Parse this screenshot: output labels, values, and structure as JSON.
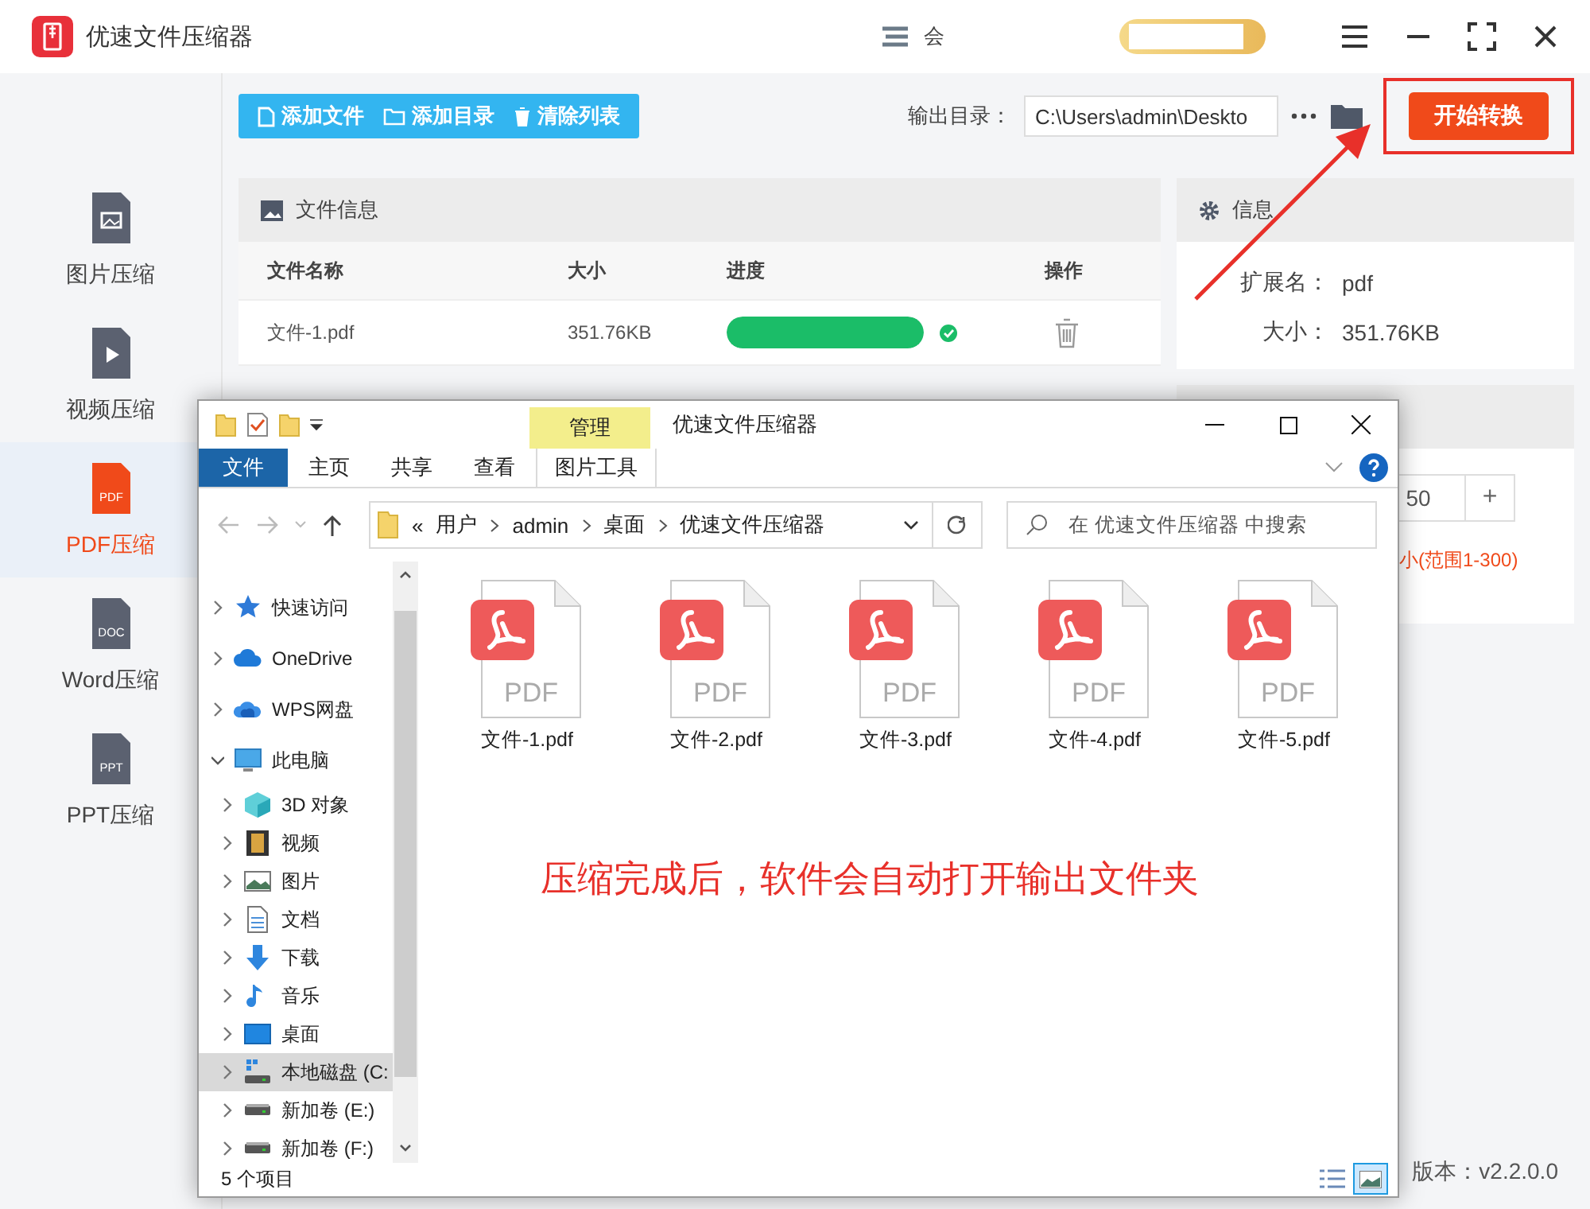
{
  "app": {
    "title": "优速文件压缩器",
    "member_text": "会",
    "version": "版本：v2.2.0.0"
  },
  "sidebar": [
    {
      "label": "图片压缩",
      "kind": "image",
      "selected": false
    },
    {
      "label": "视频压缩",
      "kind": "video",
      "selected": false
    },
    {
      "label": "PDF压缩",
      "kind": "doc",
      "icon_label": "PDF",
      "selected": true
    },
    {
      "label": "Word压缩",
      "kind": "doc",
      "icon_label": "DOC",
      "selected": false
    },
    {
      "label": "PPT压缩",
      "kind": "doc",
      "icon_label": "PPT",
      "selected": false
    }
  ],
  "toolbar": {
    "buttons": [
      {
        "label": "添加文件",
        "kind": "file"
      },
      {
        "label": "添加目录",
        "kind": "folder"
      },
      {
        "label": "清除列表",
        "kind": "trash"
      }
    ],
    "output_label": "输出目录：",
    "output_path": "C:\\Users\\admin\\Deskto",
    "start_button": "开始转换",
    "start_highlighted": true
  },
  "file_panel": {
    "title": "文件信息",
    "columns": [
      "文件名称",
      "大小",
      "进度",
      "操作"
    ],
    "rows": [
      {
        "name": "文件-1.pdf",
        "size": "351.76KB",
        "level": 1,
        "done": true
      }
    ]
  },
  "info_panel": {
    "title": "信息",
    "fields": [
      {
        "label": "扩展名：",
        "value": "pdf"
      },
      {
        "label": "大小：",
        "value": "351.76KB"
      }
    ]
  },
  "settings_panel": {
    "value": "50",
    "increment": "+",
    "hint": "小(范围1-300)"
  },
  "explorer": {
    "title": "优速文件压缩器",
    "context_tab": "管理",
    "tabs": [
      {
        "label": "文件",
        "kind": "file"
      },
      {
        "label": "主页",
        "kind": "tab"
      },
      {
        "label": "共享",
        "kind": "tab"
      },
      {
        "label": "查看",
        "kind": "tab"
      },
      {
        "label": "图片工具",
        "kind": "context"
      }
    ],
    "breadcrumb_overflow": "«",
    "breadcrumb": [
      "用户",
      "admin",
      "桌面",
      "优速文件压缩器"
    ],
    "search_placeholder": "在 优速文件压缩器 中搜索",
    "nav": [
      {
        "label": "快速访问",
        "kind": "star",
        "expanded": false,
        "selected": false
      },
      {
        "label": "OneDrive",
        "kind": "cloud",
        "expanded": false,
        "selected": false
      },
      {
        "label": "WPS网盘",
        "kind": "cloud2",
        "expanded": false,
        "selected": false
      },
      {
        "label": "此电脑",
        "kind": "pc",
        "expanded": true,
        "selected": false,
        "children": [
          {
            "label": "3D 对象",
            "kind": "cube",
            "expanded": false,
            "selected": false
          },
          {
            "label": "视频",
            "kind": "film",
            "expanded": false,
            "selected": false
          },
          {
            "label": "图片",
            "kind": "image",
            "expanded": false,
            "selected": false
          },
          {
            "label": "文档",
            "kind": "doc",
            "expanded": false,
            "selected": false
          },
          {
            "label": "下载",
            "kind": "download",
            "expanded": false,
            "selected": false
          },
          {
            "label": "音乐",
            "kind": "music",
            "expanded": false,
            "selected": false
          },
          {
            "label": "桌面",
            "kind": "desktop",
            "expanded": false,
            "selected": false
          },
          {
            "label": "本地磁盘 (C:",
            "kind": "drive-c",
            "expanded": false,
            "selected": true
          },
          {
            "label": "新加卷 (E:)",
            "kind": "drive",
            "expanded": false,
            "selected": false
          },
          {
            "label": "新加卷 (F:)",
            "kind": "drive",
            "expanded": false,
            "selected": false
          }
        ]
      }
    ],
    "files": [
      {
        "name": "文件-1.pdf",
        "icon_label": "PDF"
      },
      {
        "name": "文件-2.pdf",
        "icon_label": "PDF"
      },
      {
        "name": "文件-3.pdf",
        "icon_label": "PDF"
      },
      {
        "name": "文件-4.pdf",
        "icon_label": "PDF"
      },
      {
        "name": "文件-5.pdf",
        "icon_label": "PDF"
      }
    ],
    "status": "5 个项目"
  },
  "annotation": "压缩完成后，软件会自动打开输出文件夹"
}
